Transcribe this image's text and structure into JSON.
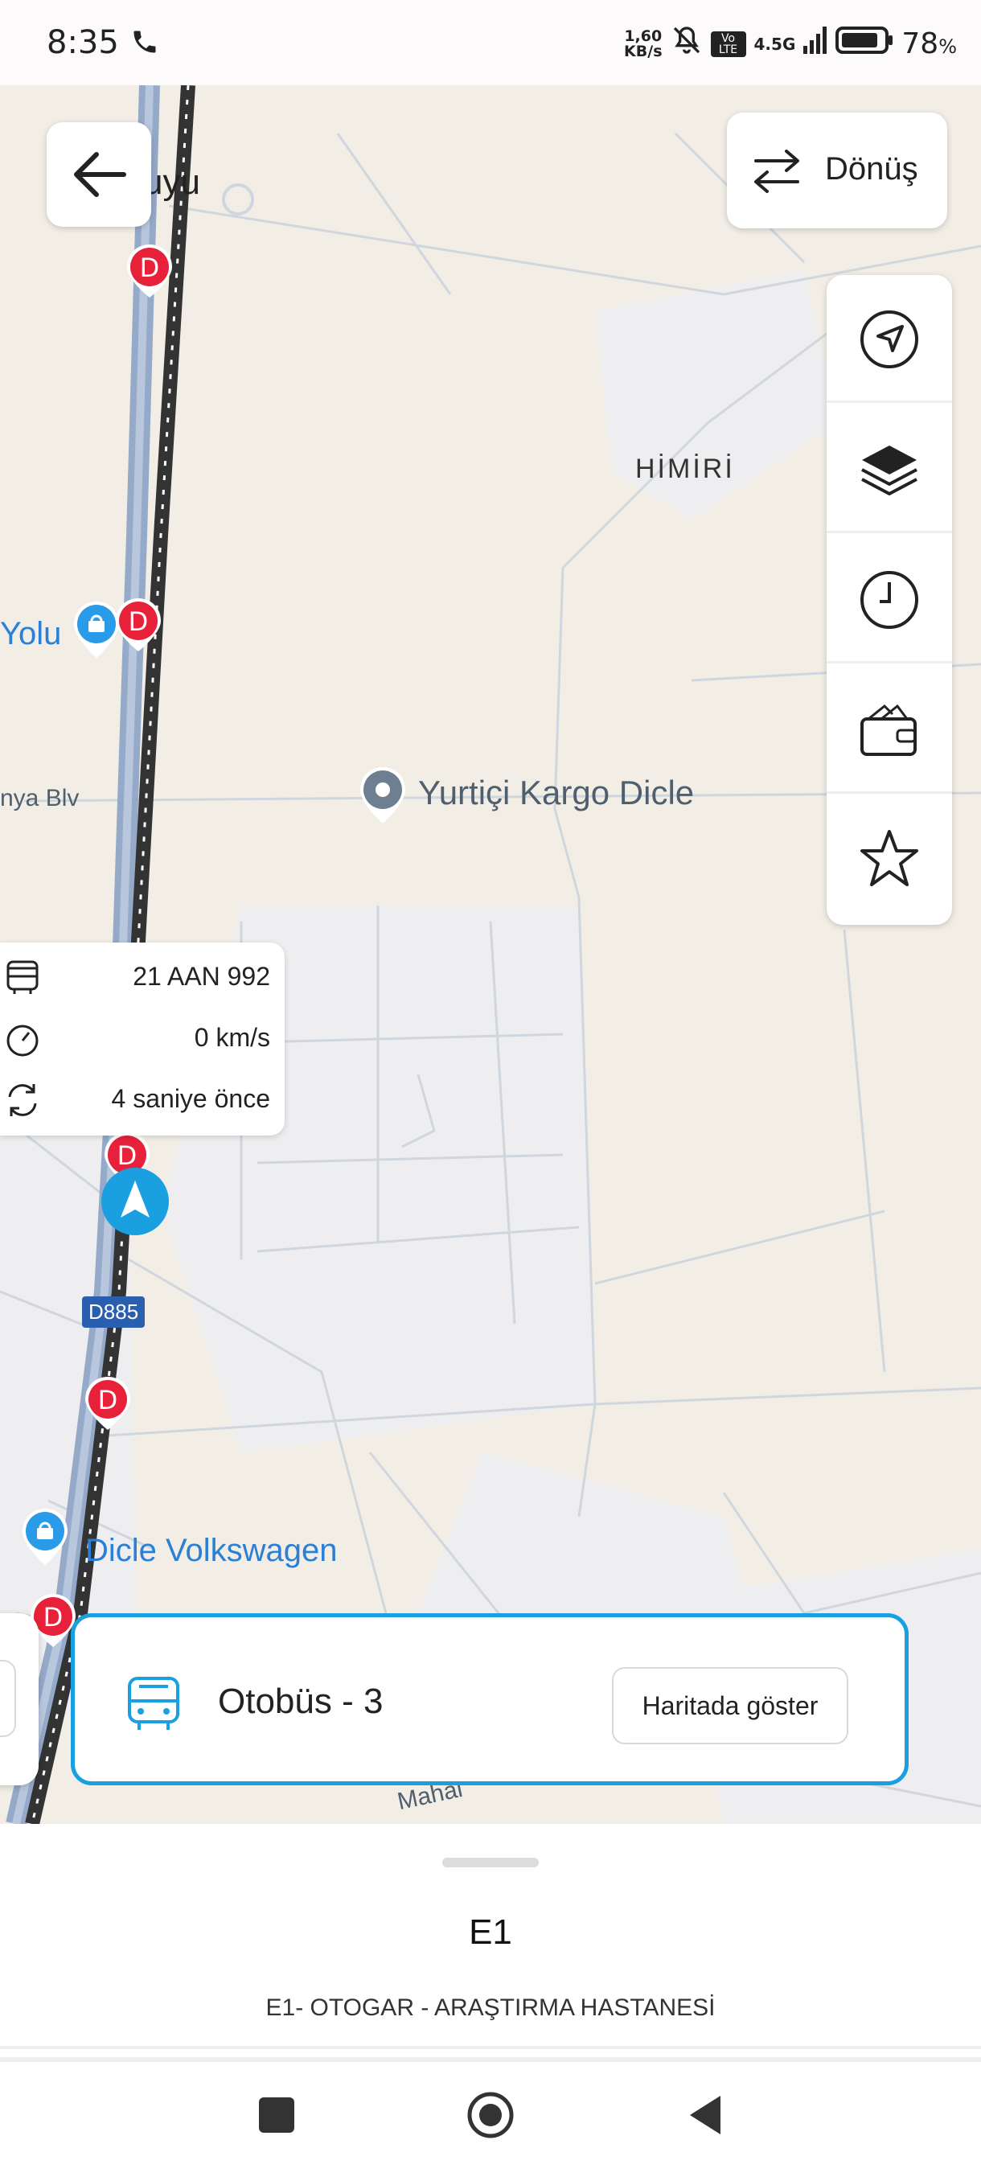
{
  "status_bar": {
    "time": "8:35",
    "net_speed_value": "1,60",
    "net_speed_unit": "KB/s",
    "volte": "Vo LTE",
    "network": "4.5G",
    "battery": "78",
    "battery_unit": "%"
  },
  "map": {
    "labels": {
      "kuyu_partial": "uyu",
      "himiri": "HİMİRİ",
      "yolu_partial": "Yolu",
      "yurtici": "Yurtiçi Kargo Dicle",
      "blv_partial": "nya Blv",
      "dicle_vw": "Dicle Volkswagen",
      "road_d885": "D885",
      "mahal_partial": "Mahal"
    },
    "stop_marker_letter": "D",
    "direction_button_label": "Dönüş",
    "tools": [
      "navigate-icon",
      "layers-icon",
      "clock-icon",
      "wallet-icon",
      "star-icon"
    ]
  },
  "vehicle_info": {
    "plate": "21 AAN 992",
    "speed": "0 km/s",
    "updated": "4 saniye önce"
  },
  "bus_card": {
    "title": "Otobüs - 3",
    "button": "Haritada göster"
  },
  "sheet": {
    "route_code": "E1",
    "route_desc": "E1- OTOGAR - ARAŞTIRMA HASTANESİ"
  }
}
